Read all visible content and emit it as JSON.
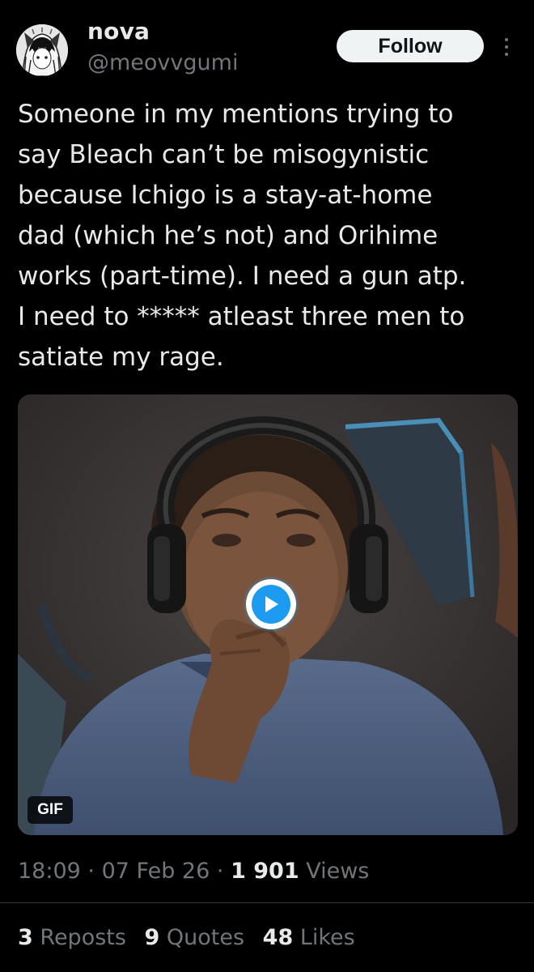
{
  "author": {
    "display_name": "nova",
    "handle": "@meovvgumi",
    "avatar_icon": "anime-girl-avatar-icon"
  },
  "actions": {
    "follow_label": "Follow",
    "more_icon": "more-vertical-icon"
  },
  "tweet": {
    "text": "Someone in my mentions trying to\nsay Bleach can’t be misogynistic\nbecause Ichigo is a stay-at-home\ndad (which he’s not) and Orihime\nworks (part-time). I need a gun atp.\nI need to ***** atleast three men to\nsatiate my rage."
  },
  "media": {
    "badge": "GIF",
    "play_icon": "play-icon"
  },
  "meta": {
    "time": "18:09",
    "separator": "·",
    "date": "07 Feb 26",
    "views_count": "1 901",
    "views_label": "Views"
  },
  "stats": {
    "reposts_count": "3",
    "reposts_label": "Reposts",
    "quotes_count": "9",
    "quotes_label": "Quotes",
    "likes_count": "48",
    "likes_label": "Likes"
  },
  "colors": {
    "background": "#000000",
    "text_primary": "#e7e9ea",
    "text_secondary": "#71767b",
    "accent": "#1d9bf0",
    "button_bg": "#eff3f4"
  }
}
